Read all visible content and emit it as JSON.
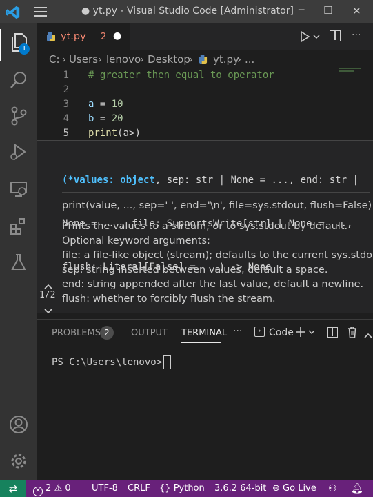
{
  "titlebar": {
    "title": "● yt.py - Visual Studio Code [Administrator]",
    "minimize_glyph": "─",
    "maximize_glyph": "☐",
    "close_glyph": "✕"
  },
  "tab": {
    "filename": "yt.py",
    "problem_count": "2",
    "modified_dot": "●"
  },
  "breadcrumb": {
    "items": [
      "C:",
      "Users",
      "lenovo",
      "Desktop",
      "yt.py",
      "..."
    ],
    "separator": "›"
  },
  "editor": {
    "lines": [
      {
        "num": "1",
        "text": "# greater then equal to operator",
        "kind": "comment"
      },
      {
        "num": "2",
        "text": "",
        "kind": "plain"
      },
      {
        "num": "3",
        "text": "a = 10",
        "kind": "assign"
      },
      {
        "num": "4",
        "text": "b = 20",
        "kind": "assign"
      },
      {
        "num": "5",
        "text": "print(a>)",
        "kind": "call"
      }
    ]
  },
  "hover": {
    "signature_lines": [
      "(*values: object, sep: str | None = ..., end: str |",
      "None = ..., file: SupportsWrite[str] | None = ...,",
      "flush: Literal[False] = ...) -> None"
    ],
    "call_sig": "print(value, ..., sep=' ', end='\\n', file=sys.stdout, flush=False)",
    "doc_lines": [
      "Prints the values to a stream, or to sys.stdout by default.",
      "Optional keyword arguments:",
      "file: a file-like object (stream); defaults to the current sys.stdout.",
      "sep: string inserted between values, default a space.",
      "end: string appended after the last value, default a newline.",
      "flush: whether to forcibly flush the stream."
    ],
    "overload": "1/2"
  },
  "panel": {
    "tabs": [
      "PROBLEMS",
      "OUTPUT",
      "TERMINAL"
    ],
    "problems_badge": "2",
    "more_glyph": "···",
    "terminal_name": "Code",
    "prompt": "PS C:\\Users\\lenovo>"
  },
  "statusbar": {
    "remote_glyph": "⇄",
    "errors": "2",
    "warnings": "0",
    "encoding": "UTF-8",
    "eol": "CRLF",
    "language": "Python",
    "interpreter": "3.6.2 64-bit",
    "golive": "Go Live"
  },
  "colors": {
    "accent_blue": "#007acc",
    "status_bg": "#68217a",
    "comment": "#6a9955",
    "number": "#b5cea8",
    "function": "#dcdcaa",
    "keyword_blue": "#9cdcfe",
    "error_red": "#f14c4c"
  }
}
